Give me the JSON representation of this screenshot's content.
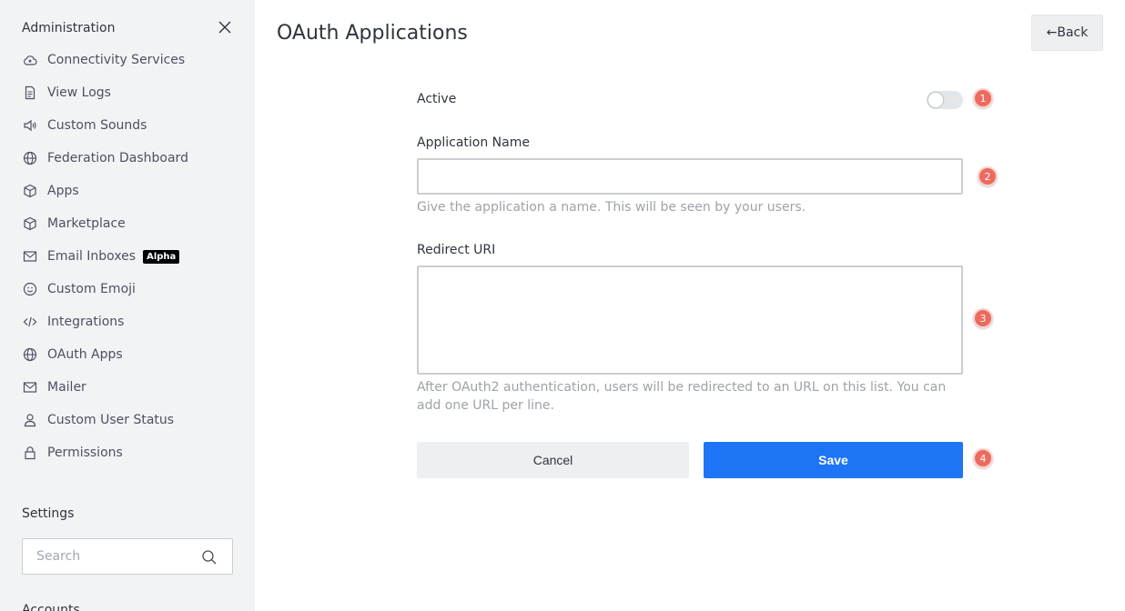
{
  "sidebar": {
    "title": "Administration",
    "items": [
      {
        "label": "Connectivity Services",
        "icon": "cloud-icon"
      },
      {
        "label": "View Logs",
        "icon": "file-icon"
      },
      {
        "label": "Custom Sounds",
        "icon": "speaker-icon"
      },
      {
        "label": "Federation Dashboard",
        "icon": "globe-icon"
      },
      {
        "label": "Apps",
        "icon": "cube-icon"
      },
      {
        "label": "Marketplace",
        "icon": "cube-icon"
      },
      {
        "label": "Email Inboxes",
        "icon": "mail-icon",
        "badge": "Alpha"
      },
      {
        "label": "Custom Emoji",
        "icon": "emoji-icon"
      },
      {
        "label": "Integrations",
        "icon": "code-icon"
      },
      {
        "label": "OAuth Apps",
        "icon": "globe-icon"
      },
      {
        "label": "Mailer",
        "icon": "mail-icon"
      },
      {
        "label": "Custom User Status",
        "icon": "user-icon"
      },
      {
        "label": "Permissions",
        "icon": "lock-icon"
      }
    ],
    "settings_title": "Settings",
    "search_placeholder": "Search",
    "accounts_title": "Accounts"
  },
  "main": {
    "title": "OAuth Applications",
    "back_label": "←Back",
    "active_label": "Active",
    "active_value": false,
    "app_name_label": "Application Name",
    "app_name_value": "",
    "app_name_hint": "Give the application a name. This will be seen by your users.",
    "redirect_label": "Redirect URI",
    "redirect_value": "",
    "redirect_hint": "After OAuth2 authentication, users will be redirected to an URL on this list. You can add one URL per line.",
    "cancel_label": "Cancel",
    "save_label": "Save"
  },
  "markers": [
    "1",
    "2",
    "3",
    "4"
  ],
  "colors": {
    "accent": "#1d74f5",
    "marker": "#ec6a5e",
    "sidebar_bg": "#f2f3f5"
  }
}
